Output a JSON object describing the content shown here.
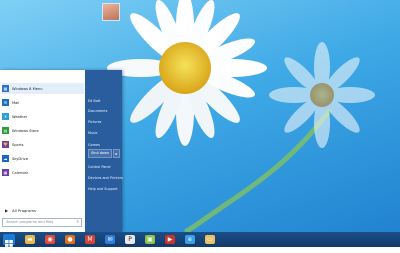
{
  "start_menu": {
    "programs": [
      {
        "label": "Windows 8 Menu",
        "icon": "start-menu-icon",
        "color": "#2f73c7"
      },
      {
        "label": "Mail",
        "icon": "mail-icon",
        "color": "#1f70c1"
      },
      {
        "label": "Weather",
        "icon": "weather-icon",
        "color": "#2aa0de"
      },
      {
        "label": "Windows Store",
        "icon": "store-icon",
        "color": "#2c9b3a"
      },
      {
        "label": "Sports",
        "icon": "sports-icon",
        "color": "#6b3fa8"
      },
      {
        "label": "SkyDrive",
        "icon": "skydrive-icon",
        "color": "#1a66c4"
      },
      {
        "label": "Calendar",
        "icon": "calendar-icon",
        "color": "#6e3ea6"
      }
    ],
    "all_programs": "All Programs",
    "search_placeholder": "Search programs and files",
    "user_links": [
      "Ed Bott",
      "Documents",
      "Pictures",
      "Music",
      "Games",
      "Computer",
      "Control Panel",
      "Devices and Printers",
      "Help and Support"
    ],
    "shutdown_label": "Shut down"
  },
  "taskbar": {
    "items": [
      {
        "icon": "file-explorer-icon",
        "color": "#e9b84a"
      },
      {
        "icon": "chrome-icon",
        "color": "#e24b3b"
      },
      {
        "icon": "firefox-icon",
        "color": "#e0711c"
      },
      {
        "icon": "gmail-icon",
        "color": "#d84436"
      },
      {
        "icon": "mail-icon",
        "color": "#2f7dd6"
      },
      {
        "icon": "powerpoint-icon",
        "color": "#e9e9e9"
      },
      {
        "icon": "android-icon",
        "color": "#8bc34a"
      },
      {
        "icon": "video-icon",
        "color": "#c9352b"
      },
      {
        "icon": "internet-explorer-icon",
        "color": "#3aa0e6"
      },
      {
        "icon": "folder-icon",
        "color": "#e6c368"
      }
    ]
  }
}
